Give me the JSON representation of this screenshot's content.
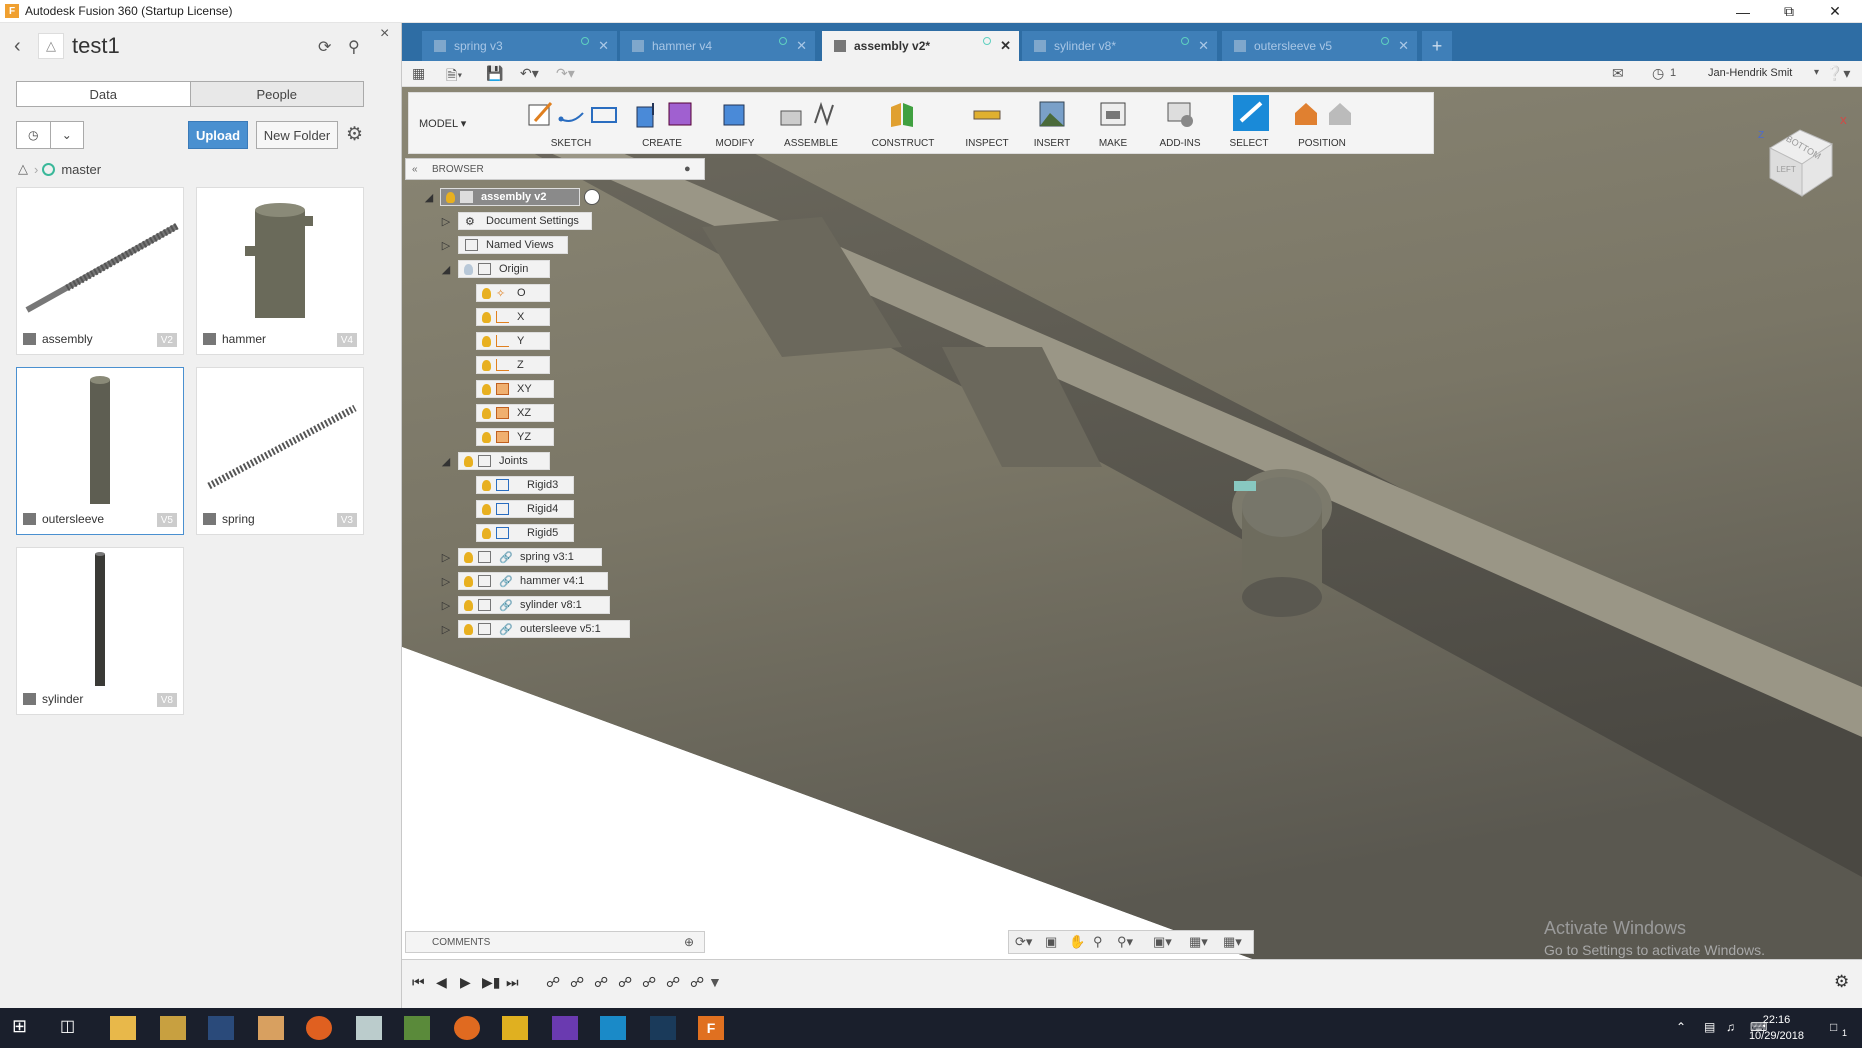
{
  "window": {
    "title": "Autodesk Fusion 360 (Startup License)",
    "app_icon": "F"
  },
  "left_panel": {
    "project": "test1",
    "tabs": [
      "Data",
      "People"
    ],
    "upload": "Upload",
    "new_folder": "New Folder",
    "branch": "master",
    "files": [
      {
        "name": "assembly",
        "version": "V2"
      },
      {
        "name": "hammer",
        "version": "V4"
      },
      {
        "name": "outersleeve",
        "version": "V5"
      },
      {
        "name": "spring",
        "version": "V3"
      },
      {
        "name": "sylinder",
        "version": "V8"
      }
    ]
  },
  "doc_tabs": [
    {
      "label": "spring v3"
    },
    {
      "label": "hammer v4"
    },
    {
      "label": "assembly v2*"
    },
    {
      "label": "sylinder v8*"
    },
    {
      "label": "outersleeve v5"
    }
  ],
  "qat": {
    "jobs": "1",
    "user": "Jan-Hendrik Smit"
  },
  "toolbar": {
    "mode": "MODEL",
    "groups": [
      "SKETCH",
      "CREATE",
      "MODIFY",
      "ASSEMBLE",
      "CONSTRUCT",
      "INSPECT",
      "INSERT",
      "MAKE",
      "ADD-INS",
      "SELECT",
      "POSITION"
    ]
  },
  "browser": {
    "title": "BROWSER",
    "root": "assembly v2",
    "items": {
      "doc_settings": "Document Settings",
      "named_views": "Named Views",
      "origin": "Origin",
      "o": "O",
      "x": "X",
      "y": "Y",
      "z": "Z",
      "xy": "XY",
      "xz": "XZ",
      "yz": "YZ",
      "joints": "Joints",
      "rigid3": "Rigid3",
      "rigid4": "Rigid4",
      "rigid5": "Rigid5",
      "spring": "spring v3:1",
      "hammer": "hammer v4:1",
      "sylinder": "sylinder v8:1",
      "outersleeve": "outersleeve v5:1"
    }
  },
  "comments": {
    "title": "COMMENTS"
  },
  "watermark": {
    "line1": "Activate Windows",
    "line2": "Go to Settings to activate Windows."
  },
  "viewcube": {
    "face": "BOTTOM",
    "side": "LEFT"
  },
  "clock": {
    "time": "22:16",
    "date": "10/29/2018"
  },
  "taskbar_badge": "1",
  "colors": {
    "accent": "#2e6da4",
    "upload": "#4a90d0",
    "bulb": "#e8b020"
  }
}
